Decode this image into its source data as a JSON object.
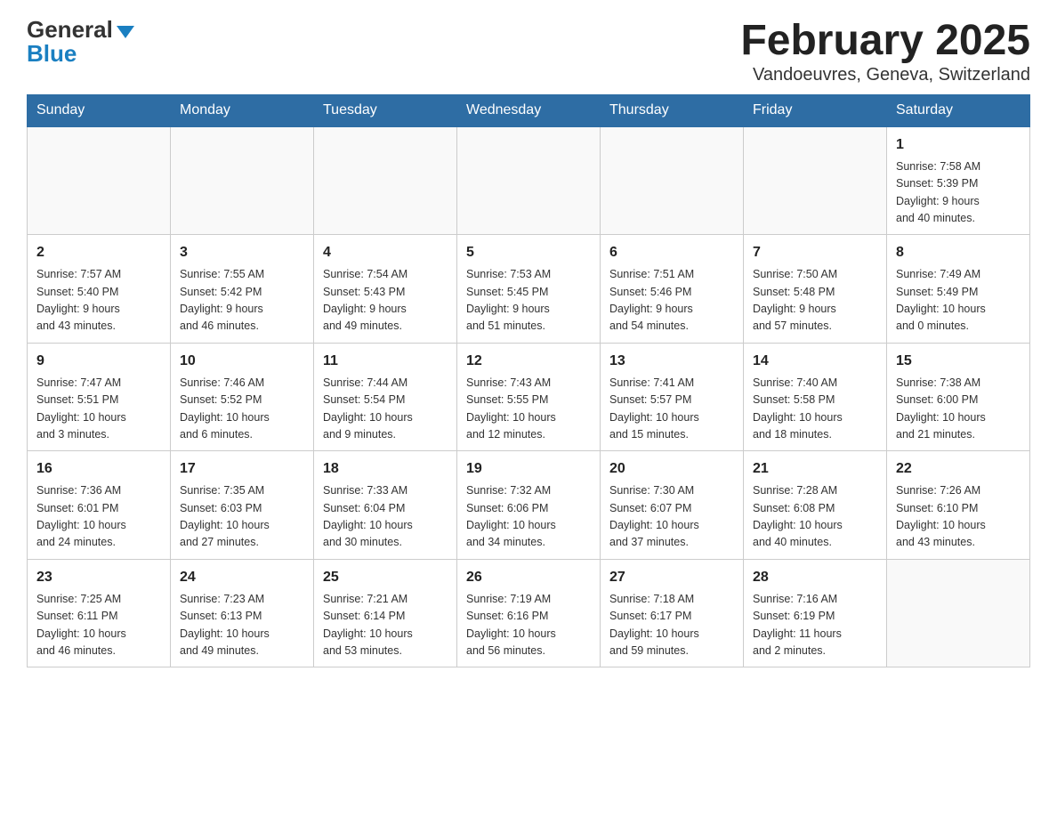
{
  "header": {
    "logo_general": "General",
    "logo_blue": "Blue",
    "title": "February 2025",
    "subtitle": "Vandoeuvres, Geneva, Switzerland"
  },
  "calendar": {
    "days_of_week": [
      "Sunday",
      "Monday",
      "Tuesday",
      "Wednesday",
      "Thursday",
      "Friday",
      "Saturday"
    ],
    "weeks": [
      [
        {
          "day": "",
          "info": ""
        },
        {
          "day": "",
          "info": ""
        },
        {
          "day": "",
          "info": ""
        },
        {
          "day": "",
          "info": ""
        },
        {
          "day": "",
          "info": ""
        },
        {
          "day": "",
          "info": ""
        },
        {
          "day": "1",
          "info": "Sunrise: 7:58 AM\nSunset: 5:39 PM\nDaylight: 9 hours\nand 40 minutes."
        }
      ],
      [
        {
          "day": "2",
          "info": "Sunrise: 7:57 AM\nSunset: 5:40 PM\nDaylight: 9 hours\nand 43 minutes."
        },
        {
          "day": "3",
          "info": "Sunrise: 7:55 AM\nSunset: 5:42 PM\nDaylight: 9 hours\nand 46 minutes."
        },
        {
          "day": "4",
          "info": "Sunrise: 7:54 AM\nSunset: 5:43 PM\nDaylight: 9 hours\nand 49 minutes."
        },
        {
          "day": "5",
          "info": "Sunrise: 7:53 AM\nSunset: 5:45 PM\nDaylight: 9 hours\nand 51 minutes."
        },
        {
          "day": "6",
          "info": "Sunrise: 7:51 AM\nSunset: 5:46 PM\nDaylight: 9 hours\nand 54 minutes."
        },
        {
          "day": "7",
          "info": "Sunrise: 7:50 AM\nSunset: 5:48 PM\nDaylight: 9 hours\nand 57 minutes."
        },
        {
          "day": "8",
          "info": "Sunrise: 7:49 AM\nSunset: 5:49 PM\nDaylight: 10 hours\nand 0 minutes."
        }
      ],
      [
        {
          "day": "9",
          "info": "Sunrise: 7:47 AM\nSunset: 5:51 PM\nDaylight: 10 hours\nand 3 minutes."
        },
        {
          "day": "10",
          "info": "Sunrise: 7:46 AM\nSunset: 5:52 PM\nDaylight: 10 hours\nand 6 minutes."
        },
        {
          "day": "11",
          "info": "Sunrise: 7:44 AM\nSunset: 5:54 PM\nDaylight: 10 hours\nand 9 minutes."
        },
        {
          "day": "12",
          "info": "Sunrise: 7:43 AM\nSunset: 5:55 PM\nDaylight: 10 hours\nand 12 minutes."
        },
        {
          "day": "13",
          "info": "Sunrise: 7:41 AM\nSunset: 5:57 PM\nDaylight: 10 hours\nand 15 minutes."
        },
        {
          "day": "14",
          "info": "Sunrise: 7:40 AM\nSunset: 5:58 PM\nDaylight: 10 hours\nand 18 minutes."
        },
        {
          "day": "15",
          "info": "Sunrise: 7:38 AM\nSunset: 6:00 PM\nDaylight: 10 hours\nand 21 minutes."
        }
      ],
      [
        {
          "day": "16",
          "info": "Sunrise: 7:36 AM\nSunset: 6:01 PM\nDaylight: 10 hours\nand 24 minutes."
        },
        {
          "day": "17",
          "info": "Sunrise: 7:35 AM\nSunset: 6:03 PM\nDaylight: 10 hours\nand 27 minutes."
        },
        {
          "day": "18",
          "info": "Sunrise: 7:33 AM\nSunset: 6:04 PM\nDaylight: 10 hours\nand 30 minutes."
        },
        {
          "day": "19",
          "info": "Sunrise: 7:32 AM\nSunset: 6:06 PM\nDaylight: 10 hours\nand 34 minutes."
        },
        {
          "day": "20",
          "info": "Sunrise: 7:30 AM\nSunset: 6:07 PM\nDaylight: 10 hours\nand 37 minutes."
        },
        {
          "day": "21",
          "info": "Sunrise: 7:28 AM\nSunset: 6:08 PM\nDaylight: 10 hours\nand 40 minutes."
        },
        {
          "day": "22",
          "info": "Sunrise: 7:26 AM\nSunset: 6:10 PM\nDaylight: 10 hours\nand 43 minutes."
        }
      ],
      [
        {
          "day": "23",
          "info": "Sunrise: 7:25 AM\nSunset: 6:11 PM\nDaylight: 10 hours\nand 46 minutes."
        },
        {
          "day": "24",
          "info": "Sunrise: 7:23 AM\nSunset: 6:13 PM\nDaylight: 10 hours\nand 49 minutes."
        },
        {
          "day": "25",
          "info": "Sunrise: 7:21 AM\nSunset: 6:14 PM\nDaylight: 10 hours\nand 53 minutes."
        },
        {
          "day": "26",
          "info": "Sunrise: 7:19 AM\nSunset: 6:16 PM\nDaylight: 10 hours\nand 56 minutes."
        },
        {
          "day": "27",
          "info": "Sunrise: 7:18 AM\nSunset: 6:17 PM\nDaylight: 10 hours\nand 59 minutes."
        },
        {
          "day": "28",
          "info": "Sunrise: 7:16 AM\nSunset: 6:19 PM\nDaylight: 11 hours\nand 2 minutes."
        },
        {
          "day": "",
          "info": ""
        }
      ]
    ]
  }
}
